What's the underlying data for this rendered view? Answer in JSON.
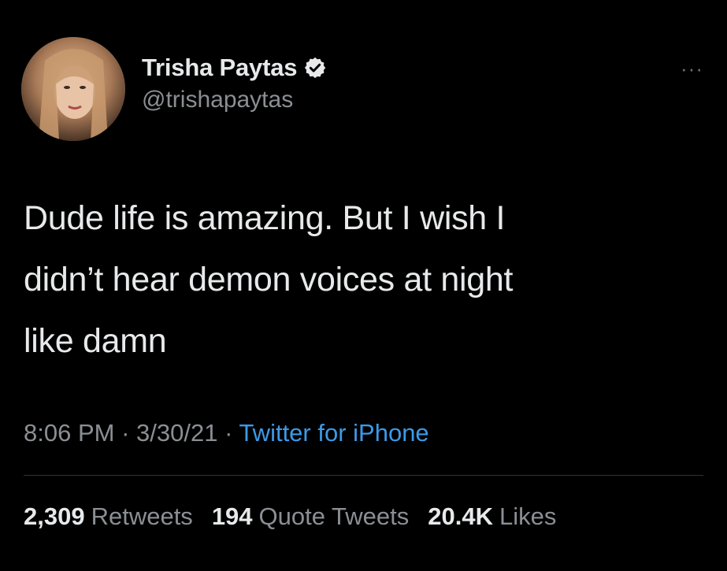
{
  "colors": {
    "background": "#000000",
    "primary_text": "#e7e9ea",
    "secondary_text": "#8b8f94",
    "link": "#3c9ae8",
    "divider": "#2f3336"
  },
  "author": {
    "display_name": "Trisha Paytas",
    "handle": "@trishapaytas",
    "verified": true,
    "avatar_icon": "profile-photo",
    "verified_icon": "verified-badge-icon"
  },
  "menu": {
    "more_label": "···",
    "more_icon": "more-options-icon"
  },
  "tweet": {
    "text": "Dude life is amazing. But I wish I\ndidn’t hear demon voices at night\nlike damn",
    "time": "8:06 PM",
    "sep1": " · ",
    "date": "3/30/21",
    "sep2": " · ",
    "source": "Twitter for iPhone"
  },
  "stats": {
    "retweets_count": "2,309",
    "retweets_label": "Retweets",
    "quotes_count": "194",
    "quotes_label": "Quote Tweets",
    "likes_count": "20.4K",
    "likes_label": "Likes"
  }
}
